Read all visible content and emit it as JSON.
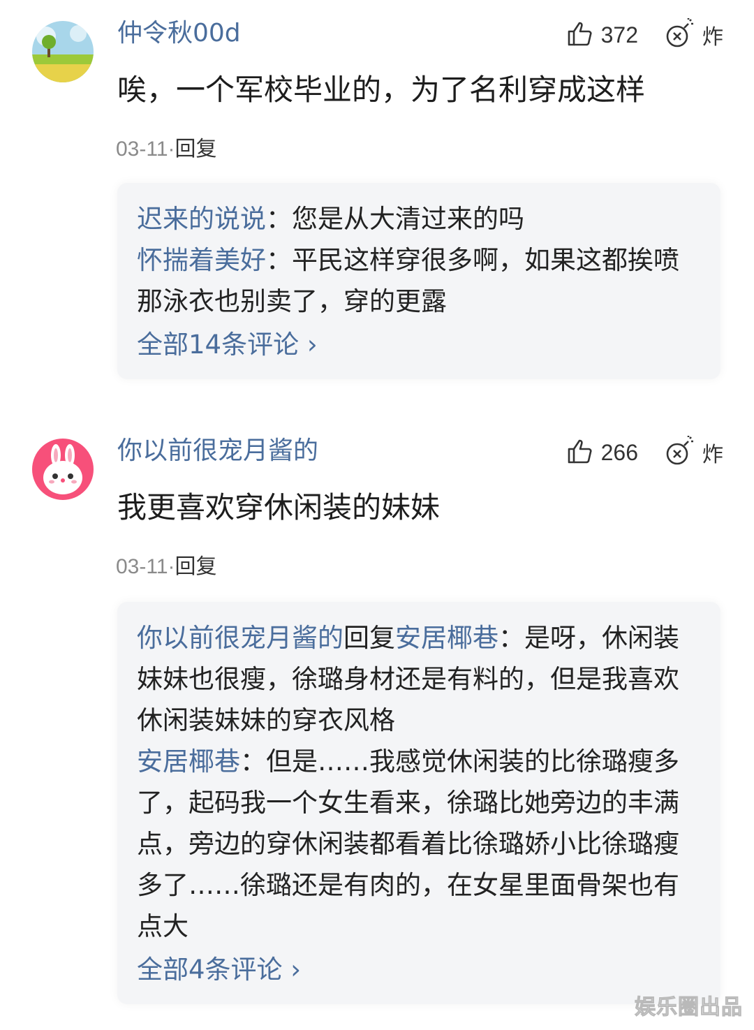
{
  "comments": [
    {
      "username": "仲令秋00d",
      "likes": "372",
      "bomb_label": "炸",
      "text": "唉，一个军校毕业的，为了名利穿成这样",
      "date": "03-11",
      "reply_label": "回复",
      "replies": [
        {
          "name": "迟来的说说",
          "colon": "：",
          "text": "您是从大清过来的吗"
        },
        {
          "name": "怀揣着美好",
          "colon": "：",
          "text": "平民这样穿很多啊，如果这都挨喷那泳衣也别卖了，穿的更露"
        }
      ],
      "view_all": "全部14条评论 ›"
    },
    {
      "username": "你以前很宠月酱的",
      "likes": "266",
      "bomb_label": "炸",
      "text": "我更喜欢穿休闲装的妹妹",
      "date": "03-11",
      "reply_label": "回复",
      "replies": [
        {
          "name": "你以前很宠月酱的",
          "mid": "回复",
          "target": "安居椰巷",
          "colon": "：",
          "text": "是呀，休闲装妹妹也很瘦，徐璐身材还是有料的，但是我喜欢休闲装妹妹的穿衣风格"
        },
        {
          "name": "安居椰巷",
          "colon": "：",
          "text": "但是……我感觉休闲装的比徐璐瘦多了，起码我一个女生看来，徐璐比她旁边的丰满点，旁边的穿休闲装都看着比徐璐娇小比徐璐瘦多了……徐璐还是有肉的，在女星里面骨架也有点大"
        }
      ],
      "view_all": "全部4条评论 ›"
    }
  ],
  "watermark": "娱乐圈出品",
  "colors": {
    "username": "#4a6d9c",
    "reply_bg": "#f4f5f7",
    "meta": "#8a8a8a"
  },
  "icons": [
    "thumbs-up-icon",
    "bomb-icon",
    "landscape-avatar",
    "bunny-avatar"
  ]
}
